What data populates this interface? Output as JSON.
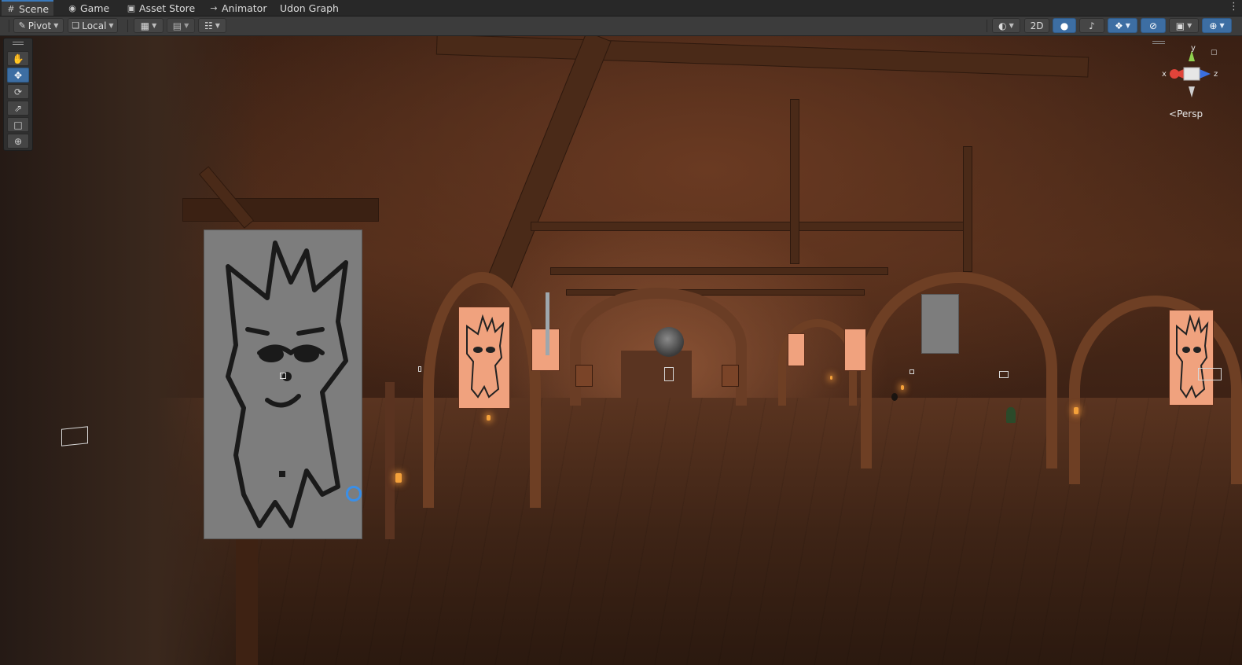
{
  "tabs": [
    {
      "label": "Scene",
      "icon": "grid-icon",
      "active": true
    },
    {
      "label": "Game",
      "icon": "gamepad-icon",
      "active": false
    },
    {
      "label": "Asset Store",
      "icon": "shopping-bag-icon",
      "active": false
    },
    {
      "label": "Animator",
      "icon": "animator-icon",
      "active": false
    },
    {
      "label": "Udon Graph",
      "icon": "",
      "active": false
    }
  ],
  "toolbar": {
    "pivot_label": "Pivot",
    "local_label": "Local",
    "mode_2d_label": "2D"
  },
  "tools": [
    {
      "name": "hand-tool",
      "icon": "hand-icon",
      "active": false
    },
    {
      "name": "move-tool",
      "icon": "move-arrows-icon",
      "active": true
    },
    {
      "name": "rotate-tool",
      "icon": "rotate-icon",
      "active": false
    },
    {
      "name": "scale-tool",
      "icon": "scale-icon",
      "active": false
    },
    {
      "name": "rect-tool",
      "icon": "rect-transform-icon",
      "active": false
    },
    {
      "name": "transform-tool",
      "icon": "transform-icon",
      "active": false
    }
  ],
  "gizmo": {
    "x_label": "x",
    "y_label": "y",
    "z_label": "z",
    "projection_label": "Persp",
    "colors": {
      "x": "#e0443a",
      "y": "#8fd14f",
      "z": "#3a6fe0"
    }
  },
  "colors": {
    "accent": "#3d6ea3",
    "poster_peach": "#f0a27e",
    "poster_gray": "#7d7d7d"
  }
}
